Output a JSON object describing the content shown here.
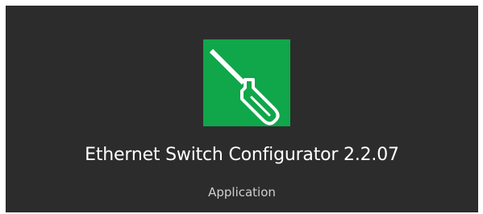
{
  "app": {
    "name": "Ethernet Switch Configurator 2.2.07",
    "type": "Application",
    "icon": "screwdriver-icon"
  },
  "colors": {
    "background": "#2c2c2c",
    "tile": "#10a64a",
    "icon_stroke": "#ffffff",
    "name_text": "#ffffff",
    "type_text": "#cfcfcf"
  }
}
